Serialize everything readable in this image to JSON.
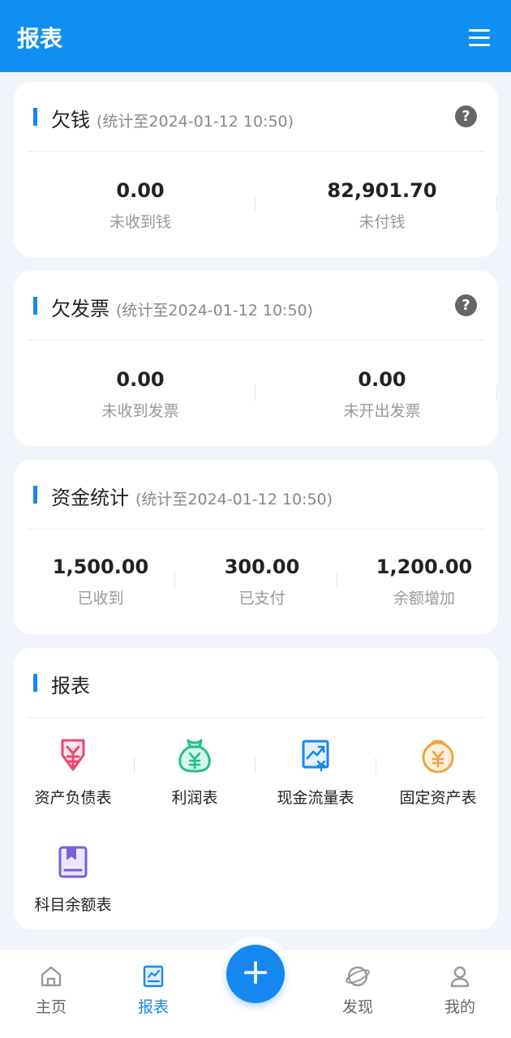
{
  "header": {
    "title": "报表",
    "menu_icon": "menu-icon"
  },
  "debt": {
    "title": "欠钱",
    "subtitle": "(统计至2024-01-12 10:50)",
    "stats": [
      {
        "value": "0.00",
        "label": "未收到钱"
      },
      {
        "value": "82,901.70",
        "label": "未付钱"
      }
    ]
  },
  "invoice": {
    "title": "欠发票",
    "subtitle": "(统计至2024-01-12 10:50)",
    "stats": [
      {
        "value": "0.00",
        "label": "未收到发票"
      },
      {
        "value": "0.00",
        "label": "未开出发票"
      }
    ]
  },
  "funds": {
    "title": "资金统计",
    "subtitle": "(统计至2024-01-12 10:50)",
    "stats": [
      {
        "value": "1,500.00",
        "label": "已收到"
      },
      {
        "value": "300.00",
        "label": "已支付"
      },
      {
        "value": "1,200.00",
        "label": "余额增加"
      }
    ]
  },
  "reports": {
    "title": "报表",
    "items": [
      {
        "label": "资产负债表",
        "icon": "balance-sheet-icon",
        "color": "#e8476f"
      },
      {
        "label": "利润表",
        "icon": "profit-bag-icon",
        "color": "#1bbf8f"
      },
      {
        "label": "现金流量表",
        "icon": "cash-flow-icon",
        "color": "#1687ee"
      },
      {
        "label": "固定资产表",
        "icon": "fixed-asset-icon",
        "color": "#f2a33a"
      },
      {
        "label": "科目余额表",
        "icon": "account-book-icon",
        "color": "#7a5fd8"
      }
    ]
  },
  "tabbar": {
    "tabs": [
      {
        "label": "主页",
        "icon": "home-icon"
      },
      {
        "label": "报表",
        "icon": "report-icon"
      },
      {
        "label": "发现",
        "icon": "planet-icon"
      },
      {
        "label": "我的",
        "icon": "user-icon"
      }
    ],
    "fab_label": "+",
    "active_color": "#1687ee"
  }
}
